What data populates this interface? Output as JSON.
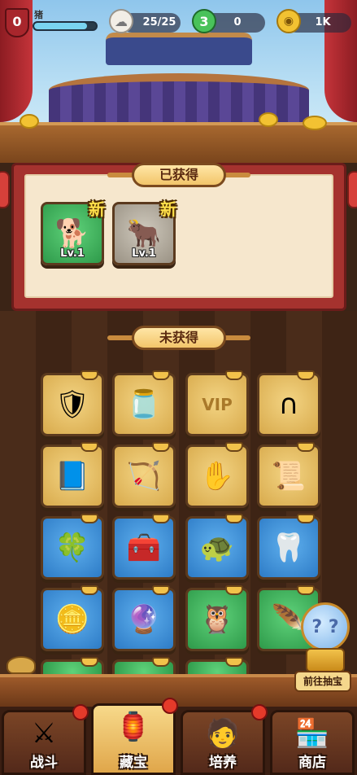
{
  "header": {
    "level": "0",
    "player_name": "猪",
    "exp_fraction": 0.85,
    "stamina": "25/25",
    "gems": "0",
    "coins": "1K",
    "stamina_icon": "cloud-bun-icon",
    "gem_icon": "green-gem-icon",
    "coin_icon": "gold-coin-icon"
  },
  "obtained": {
    "title": "已获得",
    "items": [
      {
        "name": "dog-pet",
        "level": "Lv.1",
        "new_label": "新",
        "rarity": "green"
      },
      {
        "name": "cow-pet",
        "level": "Lv.1",
        "new_label": "新",
        "rarity": "gray"
      }
    ]
  },
  "unobtained": {
    "title": "未获得",
    "items": [
      {
        "icon": "shield-emblem-icon",
        "rarity": "gold"
      },
      {
        "icon": "firefly-jar-icon",
        "rarity": "gold"
      },
      {
        "icon": "vip-card-icon",
        "rarity": "gold",
        "text": "VIP"
      },
      {
        "icon": "horseshoe-icon",
        "rarity": "gold"
      },
      {
        "icon": "spellbook-icon",
        "rarity": "gold"
      },
      {
        "icon": "crossbow-icon",
        "rarity": "gold"
      },
      {
        "icon": "golden-glove-icon",
        "rarity": "gold"
      },
      {
        "icon": "scroll-icon",
        "rarity": "gold"
      },
      {
        "icon": "four-leaf-clover-icon",
        "rarity": "blue"
      },
      {
        "icon": "treasure-chest-icon",
        "rarity": "blue"
      },
      {
        "icon": "turtle-statue-icon",
        "rarity": "blue"
      },
      {
        "icon": "fang-necklace-icon",
        "rarity": "blue"
      },
      {
        "icon": "gold-bar-icon",
        "rarity": "blue"
      },
      {
        "icon": "crystal-ball-icon",
        "rarity": "blue"
      },
      {
        "icon": "owl-totem-icon",
        "rarity": "green"
      },
      {
        "icon": "feather-fan-icon",
        "rarity": "green"
      }
    ]
  },
  "gacha": {
    "label": "前往抽宝"
  },
  "nav": {
    "items": [
      {
        "label": "战斗",
        "icon": "battle-icon"
      },
      {
        "label": "藏宝",
        "icon": "treasure-icon"
      },
      {
        "label": "培养",
        "icon": "train-icon"
      },
      {
        "label": "商店",
        "icon": "shop-icon"
      }
    ],
    "active_index": 1
  }
}
